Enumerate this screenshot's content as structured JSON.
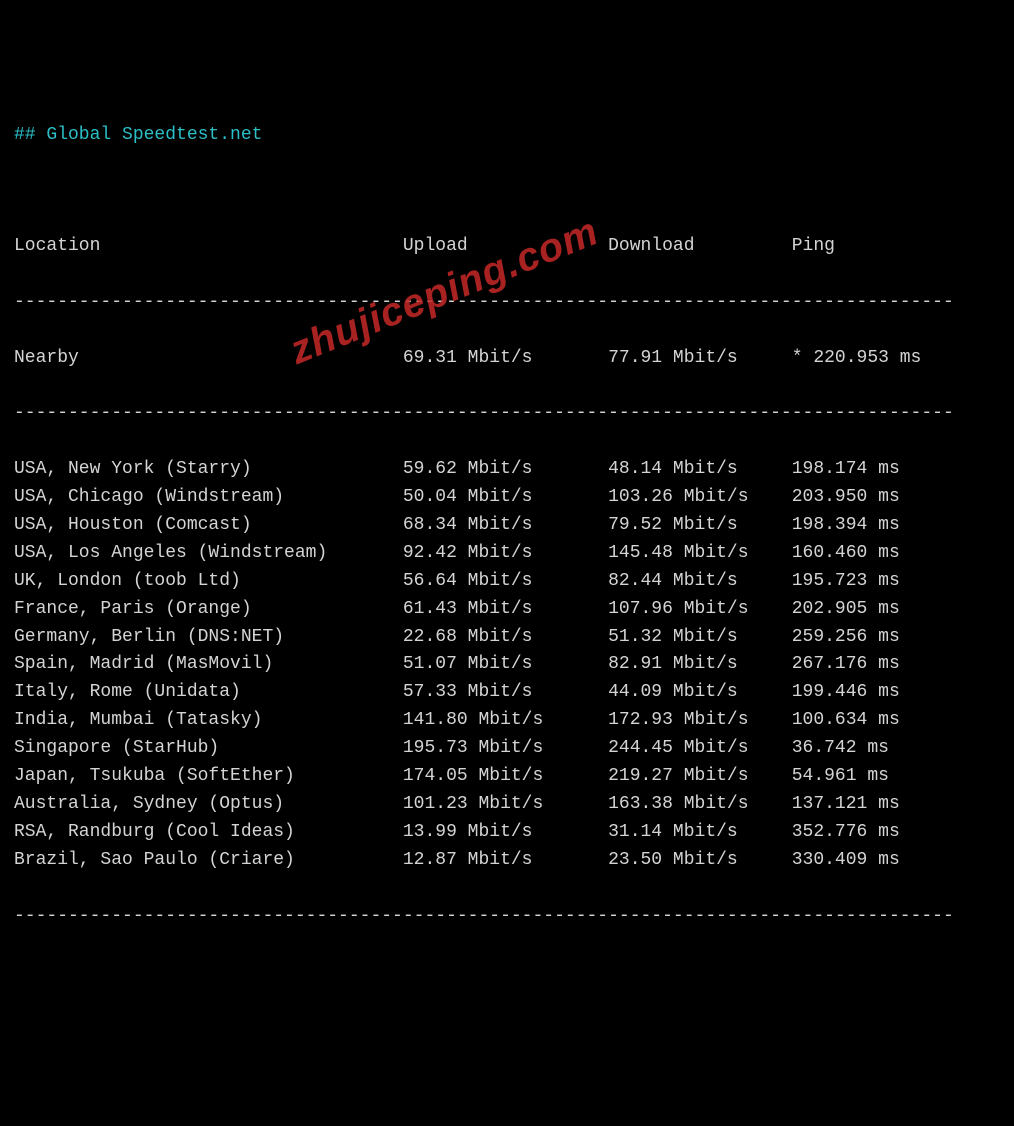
{
  "title": "## Global Speedtest.net",
  "headers": {
    "location": "Location",
    "upload": "Upload",
    "download": "Download",
    "ping": "Ping"
  },
  "nearby": {
    "location": "Nearby",
    "upload": "69.31 Mbit/s",
    "download": "77.91 Mbit/s",
    "ping": "* 220.953 ms"
  },
  "rows": [
    {
      "location": "USA, New York (Starry)",
      "upload": "59.62 Mbit/s",
      "download": "48.14 Mbit/s",
      "ping": "198.174 ms"
    },
    {
      "location": "USA, Chicago (Windstream)",
      "upload": "50.04 Mbit/s",
      "download": "103.26 Mbit/s",
      "ping": "203.950 ms"
    },
    {
      "location": "USA, Houston (Comcast)",
      "upload": "68.34 Mbit/s",
      "download": "79.52 Mbit/s",
      "ping": "198.394 ms"
    },
    {
      "location": "USA, Los Angeles (Windstream)",
      "upload": "92.42 Mbit/s",
      "download": "145.48 Mbit/s",
      "ping": "160.460 ms"
    },
    {
      "location": "UK, London (toob Ltd)",
      "upload": "56.64 Mbit/s",
      "download": "82.44 Mbit/s",
      "ping": "195.723 ms"
    },
    {
      "location": "France, Paris (Orange)",
      "upload": "61.43 Mbit/s",
      "download": "107.96 Mbit/s",
      "ping": "202.905 ms"
    },
    {
      "location": "Germany, Berlin (DNS:NET)",
      "upload": "22.68 Mbit/s",
      "download": "51.32 Mbit/s",
      "ping": "259.256 ms"
    },
    {
      "location": "Spain, Madrid (MasMovil)",
      "upload": "51.07 Mbit/s",
      "download": "82.91 Mbit/s",
      "ping": "267.176 ms"
    },
    {
      "location": "Italy, Rome (Unidata)",
      "upload": "57.33 Mbit/s",
      "download": "44.09 Mbit/s",
      "ping": "199.446 ms"
    },
    {
      "location": "India, Mumbai (Tatasky)",
      "upload": "141.80 Mbit/s",
      "download": "172.93 Mbit/s",
      "ping": "100.634 ms"
    },
    {
      "location": "Singapore (StarHub)",
      "upload": "195.73 Mbit/s",
      "download": "244.45 Mbit/s",
      "ping": "36.742 ms"
    },
    {
      "location": "Japan, Tsukuba (SoftEther)",
      "upload": "174.05 Mbit/s",
      "download": "219.27 Mbit/s",
      "ping": "54.961 ms"
    },
    {
      "location": "Australia, Sydney (Optus)",
      "upload": "101.23 Mbit/s",
      "download": "163.38 Mbit/s",
      "ping": "137.121 ms"
    },
    {
      "location": "RSA, Randburg (Cool Ideas)",
      "upload": "13.99 Mbit/s",
      "download": "31.14 Mbit/s",
      "ping": "352.776 ms"
    },
    {
      "location": "Brazil, Sao Paulo (Criare)",
      "upload": "12.87 Mbit/s",
      "download": "23.50 Mbit/s",
      "ping": "330.409 ms"
    }
  ],
  "watermark": "zhujiceping.com",
  "chart_data": {
    "type": "table",
    "title": "Global Speedtest.net",
    "columns": [
      "Location",
      "Upload",
      "Download",
      "Ping"
    ],
    "series": [
      {
        "name": "Upload (Mbit/s)",
        "values": [
          69.31,
          59.62,
          50.04,
          68.34,
          92.42,
          56.64,
          61.43,
          22.68,
          51.07,
          57.33,
          141.8,
          195.73,
          174.05,
          101.23,
          13.99,
          12.87
        ]
      },
      {
        "name": "Download (Mbit/s)",
        "values": [
          77.91,
          48.14,
          103.26,
          79.52,
          145.48,
          82.44,
          107.96,
          51.32,
          82.91,
          44.09,
          172.93,
          244.45,
          219.27,
          163.38,
          31.14,
          23.5
        ]
      },
      {
        "name": "Ping (ms)",
        "values": [
          220.953,
          198.174,
          203.95,
          198.394,
          160.46,
          195.723,
          202.905,
          259.256,
          267.176,
          199.446,
          100.634,
          36.742,
          54.961,
          137.121,
          352.776,
          330.409
        ]
      }
    ],
    "categories": [
      "Nearby",
      "USA, New York (Starry)",
      "USA, Chicago (Windstream)",
      "USA, Houston (Comcast)",
      "USA, Los Angeles (Windstream)",
      "UK, London (toob Ltd)",
      "France, Paris (Orange)",
      "Germany, Berlin (DNS:NET)",
      "Spain, Madrid (MasMovil)",
      "Italy, Rome (Unidata)",
      "India, Mumbai (Tatasky)",
      "Singapore (StarHub)",
      "Japan, Tsukuba (SoftEther)",
      "Australia, Sydney (Optus)",
      "RSA, Randburg (Cool Ideas)",
      "Brazil, Sao Paulo (Criare)"
    ]
  }
}
